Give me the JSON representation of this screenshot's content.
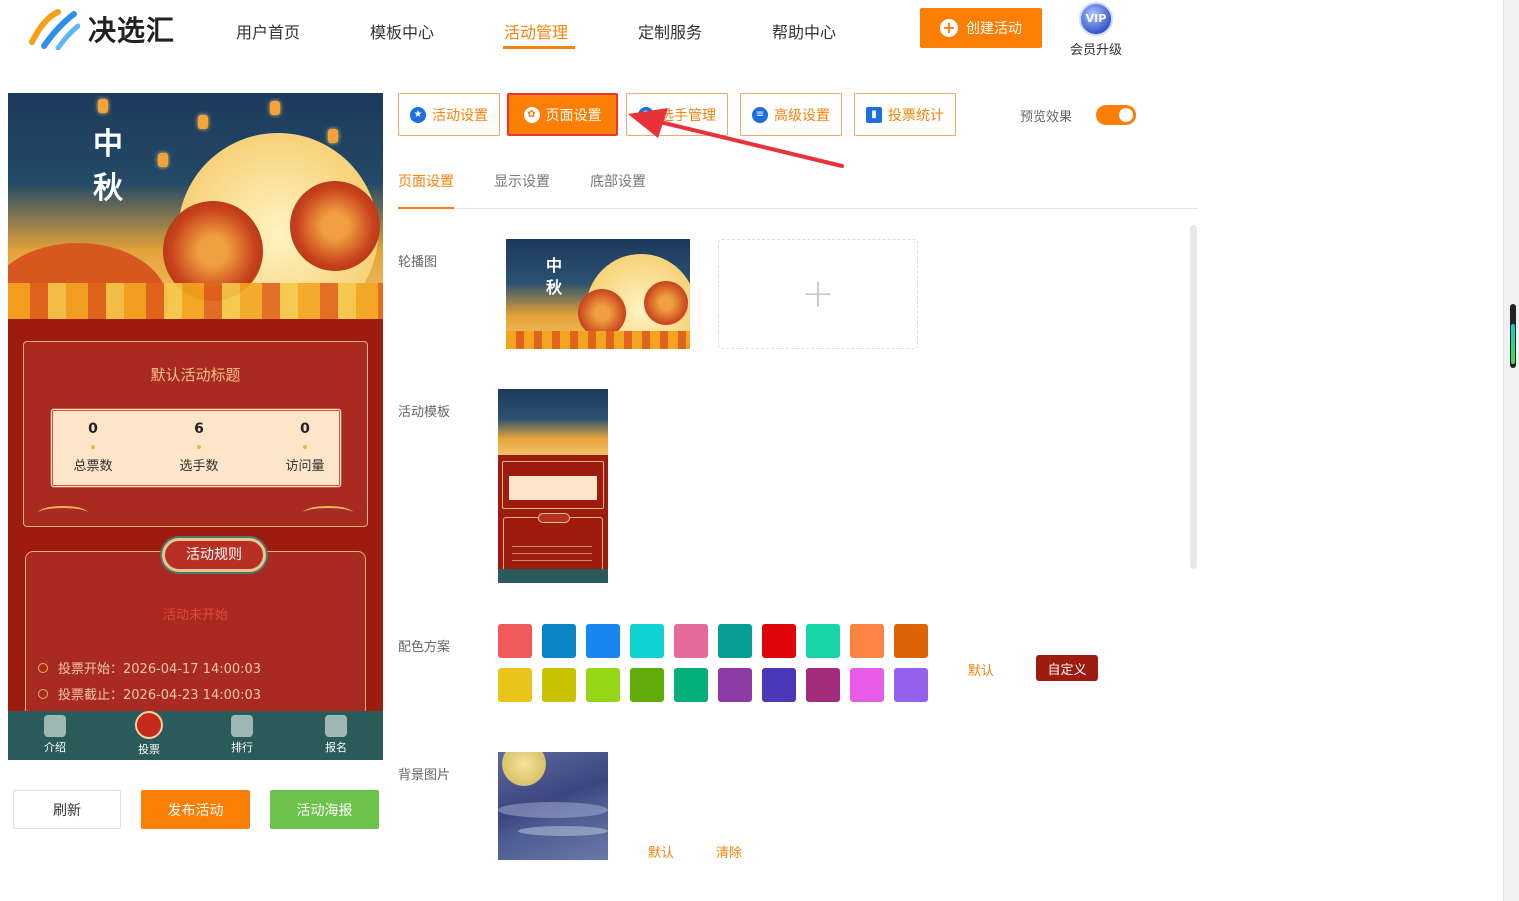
{
  "brand": {
    "name": "决选汇"
  },
  "nav": {
    "items": [
      {
        "label": "用户首页",
        "active": false
      },
      {
        "label": "模板中心",
        "active": false
      },
      {
        "label": "活动管理",
        "active": true
      },
      {
        "label": "定制服务",
        "active": false
      },
      {
        "label": "帮助中心",
        "active": false
      }
    ],
    "create_button": "创建活动",
    "vip_badge": "VIP",
    "vip_label": "会员升级"
  },
  "preview": {
    "banner_title": [
      "中",
      "秋"
    ],
    "activity_title": "默认活动标题",
    "stats": [
      {
        "value": "0",
        "label": "总票数"
      },
      {
        "value": "6",
        "label": "选手数"
      },
      {
        "value": "0",
        "label": "访问量"
      }
    ],
    "rules_label": "活动规则",
    "status_text": "活动未开始",
    "vote_start": "投票开始：2026-04-17 14:00:03",
    "vote_end": "投票截止：2026-04-23 14:00:03",
    "tabs": [
      {
        "label": "介绍",
        "icon": "megaphone-icon"
      },
      {
        "label": "投票",
        "icon": "vote-icon"
      },
      {
        "label": "排行",
        "icon": "trophy-icon"
      },
      {
        "label": "报名",
        "icon": "graduation-cap-icon"
      }
    ]
  },
  "actions": {
    "refresh": "刷新",
    "publish": "发布活动",
    "poster": "活动海报"
  },
  "settings_tabs": [
    {
      "label": "活动设置",
      "icon": "star-icon",
      "active": false
    },
    {
      "label": "页面设置",
      "icon": "gear-icon",
      "active": true
    },
    {
      "label": "选手管理",
      "icon": "users-icon",
      "active": false
    },
    {
      "label": "高级设置",
      "icon": "advanced-settings-icon",
      "active": false
    },
    {
      "label": "投票统计",
      "icon": "bar-chart-icon",
      "active": false
    }
  ],
  "preview_toggle": {
    "label": "预览效果",
    "on": true
  },
  "sub_tabs": [
    {
      "label": "页面设置",
      "active": true
    },
    {
      "label": "显示设置",
      "active": false
    },
    {
      "label": "底部设置",
      "active": false
    }
  ],
  "form": {
    "carousel_label": "轮播图",
    "template_label": "活动模板",
    "color_label": "配色方案",
    "color_default": "默认",
    "color_custom": "自定义",
    "bg_label": "背景图片",
    "bg_default": "默认",
    "bg_clear": "清除",
    "colors_row1": [
      "#f25a5a",
      "#0a84c4",
      "#1a86f0",
      "#0fd3d3",
      "#e56a9a",
      "#069e94",
      "#e0050a",
      "#17d4a6",
      "#fb8442",
      "#dd6306"
    ],
    "colors_row2": [
      "#e9c41a",
      "#c8c200",
      "#96d616",
      "#62ab08",
      "#04b07a",
      "#8d3aa9",
      "#4b38b8",
      "#a52b7c",
      "#e85be8",
      "#9361ee"
    ]
  }
}
